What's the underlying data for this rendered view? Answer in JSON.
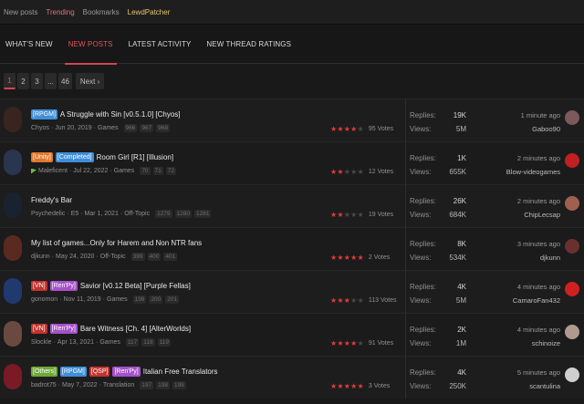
{
  "nav": {
    "items": [
      {
        "label": "New posts"
      },
      {
        "label": "Trending"
      },
      {
        "label": "Bookmarks"
      },
      {
        "label": "LewdPatcher"
      }
    ]
  },
  "tabs": [
    {
      "label": "WHAT'S NEW"
    },
    {
      "label": "NEW POSTS"
    },
    {
      "label": "LATEST ACTIVITY"
    },
    {
      "label": "NEW THREAD RATINGS"
    }
  ],
  "pagination": {
    "pages": [
      "1",
      "2",
      "3",
      "...",
      "46"
    ],
    "next": "Next ›",
    "current": "1"
  },
  "labels": {
    "replies": "Replies:",
    "views": "Views:"
  },
  "threads": [
    {
      "prefixes": [
        {
          "text": "[RPGM]",
          "kind": "rpgm"
        }
      ],
      "title": "A Struggle with Sin [v0.5.1.0] [Chyos]",
      "author": "Chyos",
      "date": "Jun 20, 2019",
      "forum": "Games",
      "pages": [
        "966",
        "967",
        "968"
      ],
      "stars_filled": 4.5,
      "votes": "95 Votes",
      "replies": "19K",
      "views": "5M",
      "latest_time": "1 minute ago",
      "latest_user": "Gaboo90",
      "avatar_color": "#3a2420",
      "small_avatar_color": "#7a5a5a"
    },
    {
      "prefixes": [
        {
          "text": "[Unity]",
          "kind": "unity"
        },
        {
          "text": "[Completed]",
          "kind": "completed"
        }
      ],
      "title": "Room Girl [R1] [Illusion]",
      "author": "Maleficent",
      "date": "Jul 22, 2022",
      "forum": "Games",
      "pages": [
        "70",
        "71",
        "72"
      ],
      "stars_filled": 2,
      "votes": "12 Votes",
      "replies": "1K",
      "views": "655K",
      "latest_time": "2 minutes ago",
      "latest_user": "Blow-videogames",
      "avatar_color": "#2a3650",
      "small_avatar_color": "#c02020",
      "flag": true
    },
    {
      "prefixes": [],
      "title": "Freddy's Bar",
      "author": "Psychedelic",
      "date": "E5 · Mar 1, 2021",
      "forum": "Off-Topic",
      "pages": [
        "1279",
        "1280",
        "1281"
      ],
      "stars_filled": 2,
      "votes": "19 Votes",
      "replies": "26K",
      "views": "684K",
      "latest_time": "2 minutes ago",
      "latest_user": "ChipLecsap",
      "avatar_color": "#1a2230",
      "small_avatar_color": "#a06050"
    },
    {
      "prefixes": [],
      "title": "My list of games...Only for Harem and Non NTR fans",
      "author": "djkunn",
      "date": "May 24, 2020",
      "forum": "Off-Topic",
      "pages": [
        "399",
        "400",
        "401"
      ],
      "stars_filled": 5,
      "votes": "2 Votes",
      "replies": "8K",
      "views": "534K",
      "latest_time": "3 minutes ago",
      "latest_user": "djkunn",
      "avatar_color": "#5a2a20",
      "small_avatar_color": "#6a3030"
    },
    {
      "prefixes": [
        {
          "text": "[VN]",
          "kind": "vn"
        },
        {
          "text": "[Ren'Py]",
          "kind": "renpy"
        }
      ],
      "title": "Savior [v0.12 Beta] [Purple Fellas]",
      "author": "gonomon",
      "date": "Nov 11, 2019",
      "forum": "Games",
      "pages": [
        "199",
        "200",
        "201"
      ],
      "stars_filled": 3.5,
      "votes": "113 Votes",
      "replies": "4K",
      "views": "5M",
      "latest_time": "4 minutes ago",
      "latest_user": "CamaroFan432",
      "avatar_color": "#203a70",
      "small_avatar_color": "#d02020"
    },
    {
      "prefixes": [
        {
          "text": "[VN]",
          "kind": "vn"
        },
        {
          "text": "[Ren'Py]",
          "kind": "renpy"
        }
      ],
      "title": "Bare Witness [Ch. 4] [AlterWorlds]",
      "author": "Slockle",
      "date": "Apr 13, 2021",
      "forum": "Games",
      "pages": [
        "117",
        "118",
        "119"
      ],
      "stars_filled": 4.5,
      "votes": "91 Votes",
      "replies": "2K",
      "views": "1M",
      "latest_time": "4 minutes ago",
      "latest_user": "schinoize",
      "avatar_color": "#6a4a40",
      "small_avatar_color": "#b09a90"
    },
    {
      "prefixes": [
        {
          "text": "[Others]",
          "kind": "others"
        },
        {
          "text": "[RPGM]",
          "kind": "rpgm"
        },
        {
          "text": "[QSP]",
          "kind": "qsp"
        },
        {
          "text": "[Ren'Py]",
          "kind": "renpy"
        }
      ],
      "title": "Italian Free Translators",
      "author": "badrot75",
      "date": "May 7, 2022",
      "forum": "Translation",
      "pages": [
        "197",
        "198",
        "199"
      ],
      "stars_filled": 5,
      "votes": "3 Votes",
      "replies": "4K",
      "views": "250K",
      "latest_time": "5 minutes ago",
      "latest_user": "scantulina",
      "avatar_color": "#7a1a25",
      "small_avatar_color": "#cfcfcf"
    }
  ]
}
